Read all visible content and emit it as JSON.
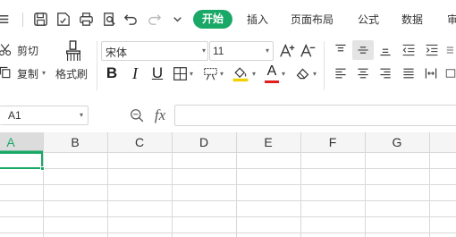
{
  "quick_access": {
    "tabs": {
      "active": "开始",
      "others": [
        "插入",
        "页面布局",
        "公式",
        "数据",
        "审"
      ]
    }
  },
  "ribbon": {
    "clipboard": {
      "cut_label": "剪切",
      "copy_label": "复制",
      "format_painter_label": "格式刷"
    },
    "font": {
      "name": "宋体",
      "size": "11",
      "bold": "B",
      "italic": "I",
      "underline": "U",
      "font_color_letter": "A",
      "highlight_color": "#f0d000",
      "font_color": "#e02020"
    }
  },
  "formula_bar": {
    "name_box": "A1",
    "fx_label": "fx",
    "content": ""
  },
  "sheet": {
    "columns": [
      "A",
      "B",
      "C",
      "D",
      "E",
      "F",
      "G"
    ],
    "selected_cell": "A1",
    "accent": "#1aa867"
  }
}
